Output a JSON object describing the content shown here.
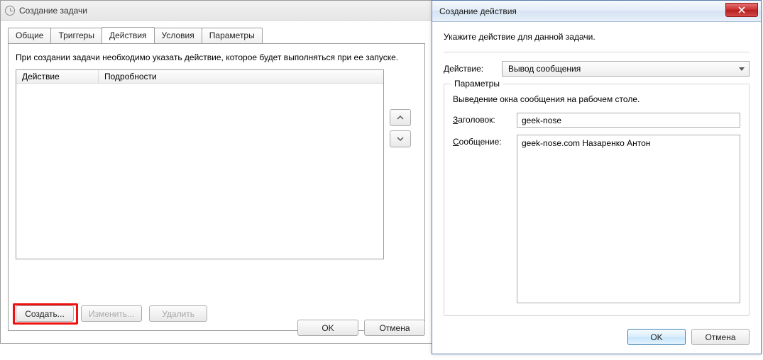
{
  "task_dialog": {
    "title": "Создание задачи",
    "tabs": {
      "common": "Общие",
      "triggers": "Триггеры",
      "actions": "Действия",
      "conditions": "Условия",
      "params": "Параметры"
    },
    "instruction": "При создании задачи необходимо указать действие, которое будет выполняться при ее запуске.",
    "columns": {
      "action": "Действие",
      "details": "Подробности"
    },
    "buttons": {
      "create": "Создать...",
      "edit": "Изменить...",
      "delete": "Удалить"
    },
    "footer": {
      "ok": "OK",
      "cancel": "Отмена"
    }
  },
  "action_dialog": {
    "title": "Создание действия",
    "prompt": "Укажите действие для данной задачи.",
    "action_label_pre": "Д",
    "action_label_post": "ействие:",
    "action_value": "Вывод сообщения",
    "group_legend": "Параметры",
    "subtext": "Выведение  окна сообщения на рабочем столе.",
    "header_label_pre": "З",
    "header_label_post": "аголовок:",
    "header_value": "geek-nose",
    "message_label_pre": "С",
    "message_label_post": "ообщение:",
    "message_value": "geek-nose.com Назаренко Антон",
    "footer": {
      "ok": "OK",
      "cancel": "Отмена"
    }
  }
}
